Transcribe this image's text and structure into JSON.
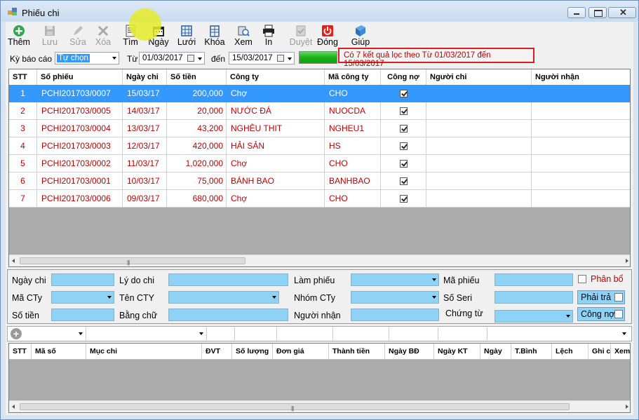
{
  "window": {
    "title": "Phiếu chi"
  },
  "toolbar": [
    {
      "name": "add-button",
      "icon": "add-icon",
      "label": "Thêm",
      "enabled": true
    },
    {
      "name": "save-button",
      "icon": "save-icon",
      "label": "Lưu",
      "enabled": false
    },
    {
      "name": "edit-button",
      "icon": "edit-icon",
      "label": "Sửa",
      "enabled": false
    },
    {
      "name": "delete-button",
      "icon": "delete-icon",
      "label": "Xóa",
      "enabled": false
    },
    {
      "name": "search-button",
      "icon": "search-icon",
      "label": "Tìm",
      "enabled": true
    },
    {
      "name": "date-button",
      "icon": "calendar-icon",
      "label": "Ngày",
      "enabled": true
    },
    {
      "name": "grid-button",
      "icon": "grid-icon",
      "label": "Lưới",
      "enabled": true
    },
    {
      "name": "lock-button",
      "icon": "lock-icon",
      "label": "Khóa",
      "enabled": true
    },
    {
      "name": "view-button",
      "icon": "view-icon",
      "label": "Xem",
      "enabled": true
    },
    {
      "name": "print-button",
      "icon": "print-icon",
      "label": "In",
      "enabled": true
    },
    {
      "name": "approve-button",
      "icon": "approve-icon",
      "label": "Duyệt",
      "enabled": false
    },
    {
      "name": "close-button",
      "icon": "power-icon",
      "label": "Đóng",
      "enabled": true
    },
    {
      "name": "help-button",
      "icon": "help-book-icon",
      "label": "Giúp",
      "enabled": true
    }
  ],
  "filter": {
    "period_label": "Kỳ báo cáo",
    "period_value": "Tự chọn",
    "from_label": "Từ",
    "from_date": "01/03/2017",
    "to_label": "đến",
    "to_date": "15/03/2017",
    "result_text": "Có 7 kết quả lọc theo Từ 01/03/2017 đến 15/03/2017"
  },
  "main_grid": {
    "columns": [
      "STT",
      "Số phiếu",
      "Ngày chi",
      "Số tiền",
      "Công ty",
      "Mã công ty",
      "Công nợ",
      "Người chi",
      "Người nhận"
    ],
    "rows": [
      {
        "stt": "1",
        "so_phieu": "PCHI201703/0007",
        "ngay_chi": "15/03/17",
        "so_tien": "200,000",
        "cong_ty": "Chợ",
        "ma_cong_ty": "CHO",
        "cong_no": true,
        "nguoi_chi": "",
        "nguoi_nhan": "",
        "selected": true
      },
      {
        "stt": "2",
        "so_phieu": "PCHI201703/0005",
        "ngay_chi": "14/03/17",
        "so_tien": "20,000",
        "cong_ty": "NƯỚC ĐÁ",
        "ma_cong_ty": "NUOCDA",
        "cong_no": true,
        "nguoi_chi": "",
        "nguoi_nhan": "",
        "selected": false
      },
      {
        "stt": "3",
        "so_phieu": "PCHI201703/0004",
        "ngay_chi": "13/03/17",
        "so_tien": "43,200",
        "cong_ty": "NGHÊU THIT",
        "ma_cong_ty": "NGHEU1",
        "cong_no": true,
        "nguoi_chi": "",
        "nguoi_nhan": "",
        "selected": false
      },
      {
        "stt": "4",
        "so_phieu": "PCHI201703/0003",
        "ngay_chi": "12/03/17",
        "so_tien": "420,000",
        "cong_ty": "HẢI SẢN",
        "ma_cong_ty": "HS",
        "cong_no": true,
        "nguoi_chi": "",
        "nguoi_nhan": "",
        "selected": false
      },
      {
        "stt": "5",
        "so_phieu": "PCHI201703/0002",
        "ngay_chi": "11/03/17",
        "so_tien": "1,020,000",
        "cong_ty": "Chợ",
        "ma_cong_ty": "CHO",
        "cong_no": true,
        "nguoi_chi": "",
        "nguoi_nhan": "",
        "selected": false
      },
      {
        "stt": "6",
        "so_phieu": "PCHI201703/0001",
        "ngay_chi": "10/03/17",
        "so_tien": "75,000",
        "cong_ty": "BÁNH BAO",
        "ma_cong_ty": "BANHBAO",
        "cong_no": true,
        "nguoi_chi": "",
        "nguoi_nhan": "",
        "selected": false
      },
      {
        "stt": "7",
        "so_phieu": "PCHI201703/0006",
        "ngay_chi": "09/03/17",
        "so_tien": "680,000",
        "cong_ty": "Chợ",
        "ma_cong_ty": "CHO",
        "cong_no": true,
        "nguoi_chi": "",
        "nguoi_nhan": "",
        "selected": false
      }
    ]
  },
  "form": {
    "ngay_chi": "Ngày chi",
    "ly_do_chi": "Lý do chi",
    "lam_phieu": "Làm phiếu",
    "ma_phieu": "Mã phiếu",
    "phan_bo": "Phân bổ",
    "ma_cty": "Mã CTy",
    "ten_cty": "Tên CTY",
    "nhom_cty": "Nhóm CTy",
    "so_seri": "Số Seri",
    "phai_tra": "Phải trả",
    "so_tien": "Số tiền",
    "bang_chu": "Bằng chữ",
    "nguoi_nhan": "Người nhận",
    "chung_tu": "Chứng từ",
    "cong_no": "Công nợ"
  },
  "detail_grid": {
    "columns": [
      "STT",
      "Mã số",
      "Mục chi",
      "ĐVT",
      "Số lượng",
      "Đơn giá",
      "Thành tiền",
      "Ngày BĐ",
      "Ngày KT",
      "Ngày",
      "T.Bình",
      "Lệch",
      "Ghi chú",
      "Xem"
    ]
  },
  "colors": {
    "accent_red": "#c00000",
    "selection": "#3399ff",
    "field_blue": "#8ed3f5"
  }
}
